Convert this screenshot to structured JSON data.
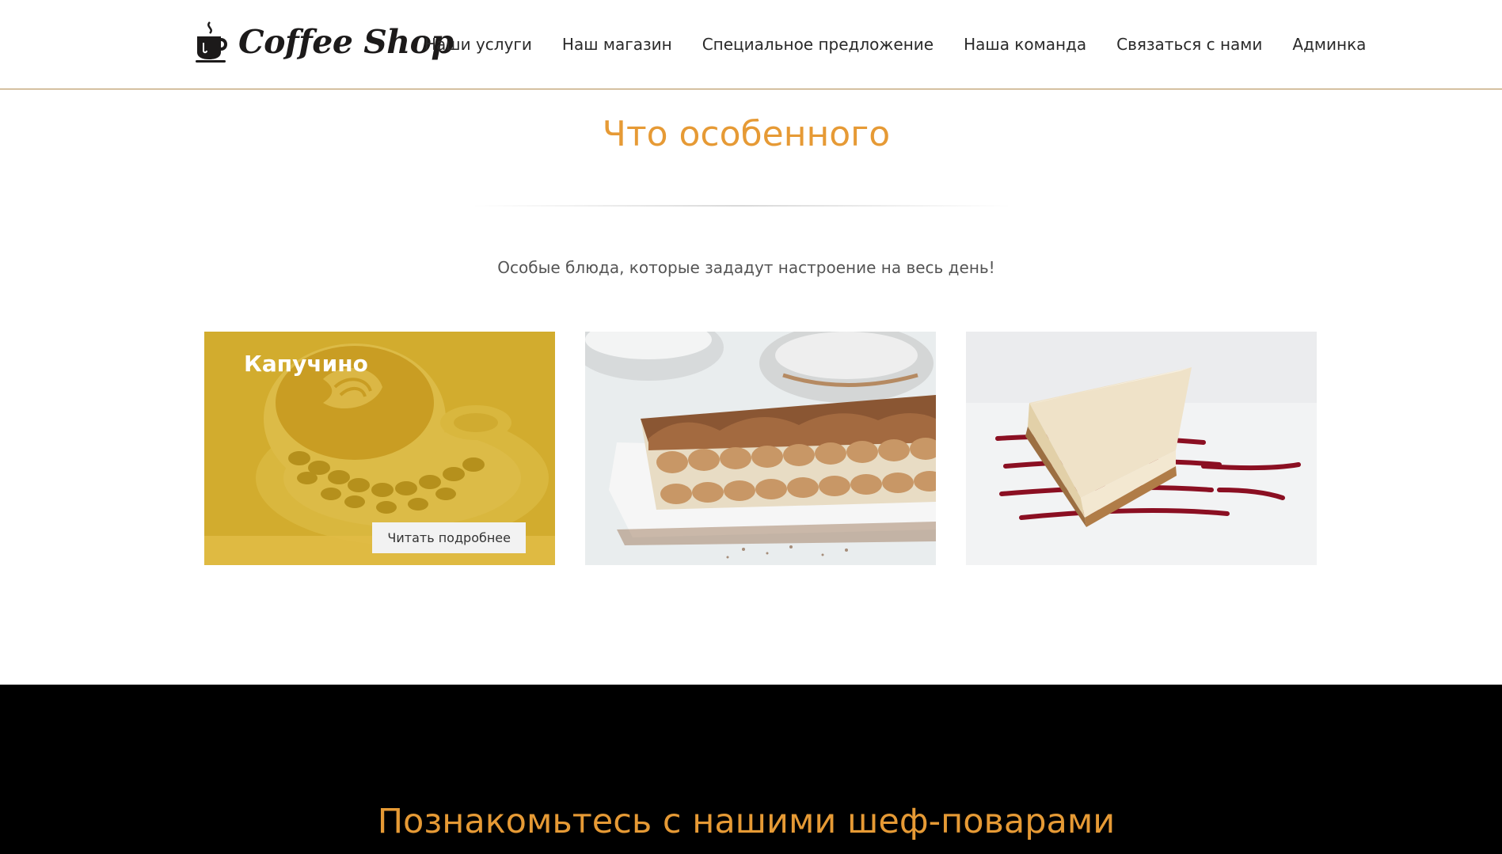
{
  "header": {
    "logo_text": "Coffee Shop",
    "logo_icon": "coffee-cup-icon",
    "nav": [
      {
        "label": "Наши услуги"
      },
      {
        "label": "Наш магазин"
      },
      {
        "label": "Специальное предложение"
      },
      {
        "label": "Наша команда"
      },
      {
        "label": "Связаться с нами"
      },
      {
        "label": "Админка"
      }
    ]
  },
  "special": {
    "title": "Что особенного",
    "subtitle": "Особые блюда, которые зададут настроение на весь день!",
    "cards": [
      {
        "title": "Капучино",
        "button": "Читать подробнее",
        "image": "cappuccino-photo"
      },
      {
        "image": "tiramisu-photo"
      },
      {
        "image": "cheesecake-photo"
      }
    ]
  },
  "chefs": {
    "title": "Познакомьтесь с нашими шеф-поварами"
  },
  "colors": {
    "accent": "#e69a35",
    "header_border": "#b08a4e",
    "card_overlay": "#c9a21c",
    "dark_bg": "#000000"
  }
}
